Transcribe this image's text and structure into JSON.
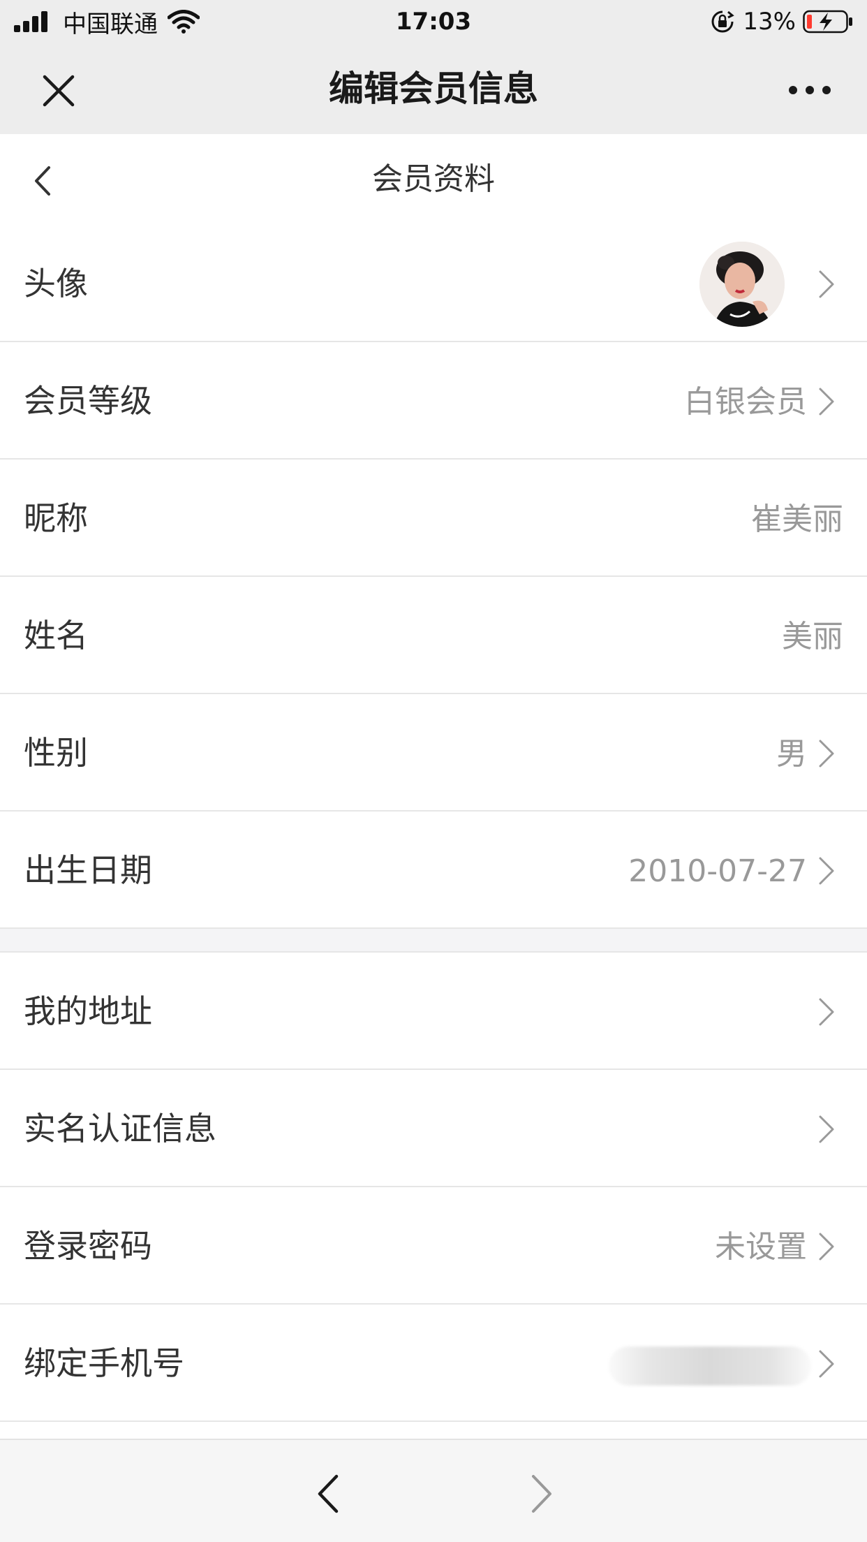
{
  "status_bar": {
    "carrier": "中国联通",
    "time": "17:03",
    "battery_percent": "13%"
  },
  "nav_bar": {
    "title": "编辑会员信息"
  },
  "page": {
    "title": "会员资料"
  },
  "rows": [
    {
      "label": "头像",
      "value": ""
    },
    {
      "label": "会员等级",
      "value": "白银会员"
    },
    {
      "label": "昵称",
      "value": "崔美丽"
    },
    {
      "label": "姓名",
      "value": "美丽"
    },
    {
      "label": "性别",
      "value": "男"
    },
    {
      "label": "出生日期",
      "value": "2010-07-27"
    },
    {
      "label": "我的地址",
      "value": ""
    },
    {
      "label": "实名认证信息",
      "value": ""
    },
    {
      "label": "登录密码",
      "value": "未设置"
    },
    {
      "label": "绑定手机号",
      "value": ""
    }
  ],
  "colors": {
    "bar_background": "#ededed",
    "label": "#333333",
    "value": "#999999",
    "divider": "#e6e6e6",
    "battery_low": "#ff3b30"
  }
}
